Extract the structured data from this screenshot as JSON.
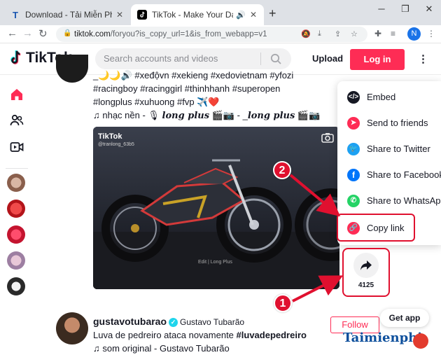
{
  "browser": {
    "tabs": [
      {
        "title": "Download - Tải Miễn Phí VN - Ph",
        "icon": "T",
        "active": false
      },
      {
        "title": "TikTok - Make Your Day",
        "icon": "tiktok-icon",
        "active": true
      }
    ],
    "new_tab": "+",
    "url": {
      "host": "tiktok.com",
      "path": "/foryou?is_copy_url=1&is_from_webapp=v1"
    },
    "profile_initial": "N"
  },
  "tiktok": {
    "logo": "TikTok",
    "search_placeholder": "Search accounts and videos",
    "upload": "Upload",
    "login": "Log in"
  },
  "feed": {
    "post1": {
      "caption_line1": "_🌙🌙🔊 #xeđộvn #xekieng #xedovietnam #yfozi",
      "caption_line2": "#racingboy #racinggirl #thinhhanh #superopen",
      "caption_line3": "#longplus #xuhuong #fvp ✈️❤️",
      "sound_prefix": "♫  nhạc nền - 🎙",
      "sound_italic1": "long plus",
      "sound_mid": "🎬📷 - _",
      "sound_italic2": "long plus",
      "sound_suffix": "🎬📷",
      "video_logo": "TikTok",
      "video_user": "@tranlong_63b5",
      "video_watermark": "Edit | Long Plus",
      "share_count": "4125"
    },
    "post2": {
      "username": "gustavotubarao",
      "nickname": "Gustavo Tubarão",
      "caption": "Luva de pedreiro ataca novamente ",
      "caption_tag": "#luvadepedreiro",
      "sound": "♫  som original - Gustavo Tubarão",
      "follow": "Follow"
    }
  },
  "share_menu": [
    {
      "label": "Embed",
      "icon": "embed-icon",
      "color": "#161823"
    },
    {
      "label": "Send to friends",
      "icon": "send-icon",
      "color": "#fe2c55"
    },
    {
      "label": "Share to Twitter",
      "icon": "twitter-icon",
      "color": "#1da1f2"
    },
    {
      "label": "Share to Facebook",
      "icon": "facebook-icon",
      "color": "#0075fa"
    },
    {
      "label": "Share to WhatsApp",
      "icon": "whatsapp-icon",
      "color": "#25d366"
    },
    {
      "label": "Copy link",
      "icon": "link-icon",
      "color": "#fe2c55"
    }
  ],
  "annotations": {
    "step1": "1",
    "step2": "2"
  },
  "get_app": "Get app",
  "watermark": "Taimienphi",
  "colors": {
    "accent": "#fe2c55",
    "annotation": "#e0102f"
  }
}
